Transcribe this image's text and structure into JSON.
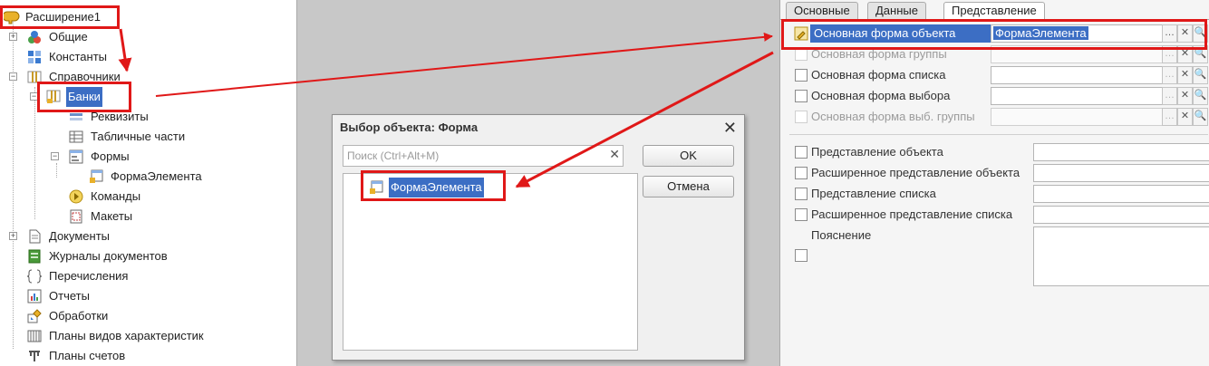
{
  "tree": {
    "root": "Расширение1",
    "items": [
      {
        "label": "Общие",
        "icon": "common-icon"
      },
      {
        "label": "Константы",
        "icon": "constants-icon"
      },
      {
        "label": "Справочники",
        "icon": "catalogs-icon"
      },
      {
        "label": "Банки",
        "icon": "catalog-item-icon"
      },
      {
        "label": "Реквизиты",
        "icon": "attributes-icon"
      },
      {
        "label": "Табличные части",
        "icon": "tabular-sections-icon"
      },
      {
        "label": "Формы",
        "icon": "forms-icon"
      },
      {
        "label": "ФормаЭлемента",
        "icon": "form-icon"
      },
      {
        "label": "Команды",
        "icon": "commands-icon"
      },
      {
        "label": "Макеты",
        "icon": "templates-icon"
      },
      {
        "label": "Документы",
        "icon": "documents-icon"
      },
      {
        "label": "Журналы документов",
        "icon": "journals-icon"
      },
      {
        "label": "Перечисления",
        "icon": "enums-icon"
      },
      {
        "label": "Отчеты",
        "icon": "reports-icon"
      },
      {
        "label": "Обработки",
        "icon": "data-processors-icon"
      },
      {
        "label": "Планы видов характеристик",
        "icon": "chart-of-characteristics-icon"
      },
      {
        "label": "Планы счетов",
        "icon": "chart-of-accounts-icon"
      }
    ]
  },
  "dialog": {
    "title": "Выбор объекта: Форма",
    "search_placeholder": "Поиск (Ctrl+Alt+M)",
    "ok_label": "OK",
    "cancel_label": "Отмена",
    "list_item": "ФормаЭлемента"
  },
  "props": {
    "tabs": [
      "Основные",
      "Данные",
      "Представление"
    ],
    "active_tab": "Представление",
    "forms": [
      {
        "label": "Основная форма объекта",
        "value": "ФормаЭлемента",
        "enabled": true
      },
      {
        "label": "Основная форма группы",
        "value": "",
        "enabled": false
      },
      {
        "label": "Основная форма списка",
        "value": "",
        "enabled": true
      },
      {
        "label": "Основная форма выбора",
        "value": "",
        "enabled": true
      },
      {
        "label": "Основная форма выб. группы",
        "value": "",
        "enabled": false
      }
    ],
    "presentations": [
      {
        "label": "Представление объекта"
      },
      {
        "label": "Расширенное представление объекта"
      },
      {
        "label": "Представление списка"
      },
      {
        "label": "Расширенное представление списка"
      }
    ],
    "explanation_label": "Пояснение"
  },
  "colors": {
    "selection": "#3c6ec4",
    "annotation": "#e01818"
  }
}
